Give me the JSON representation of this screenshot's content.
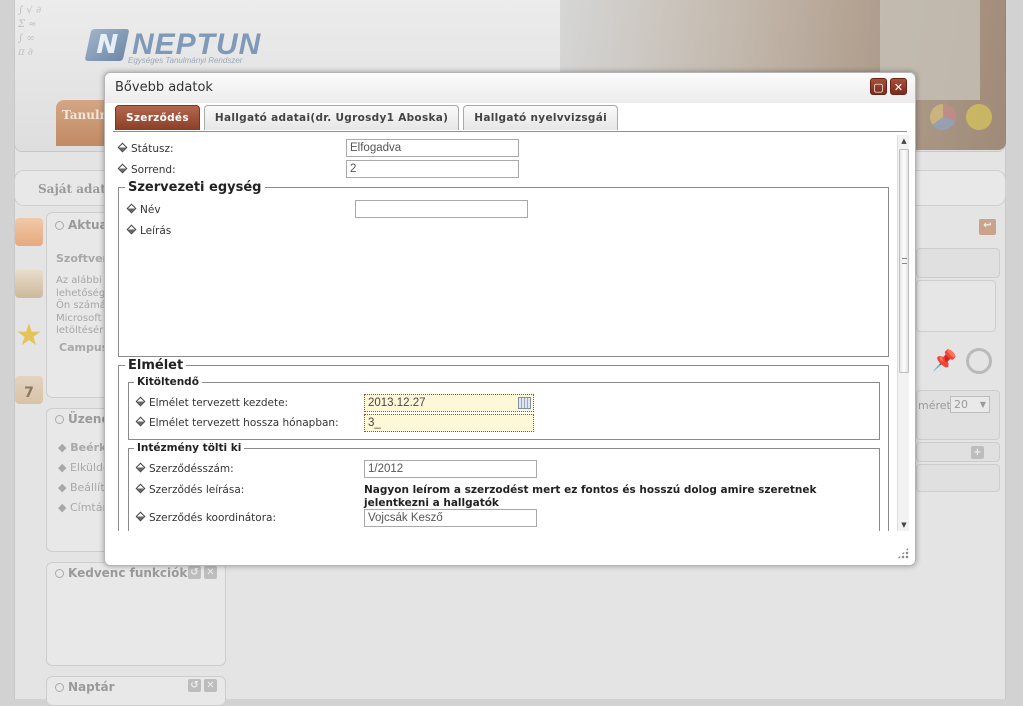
{
  "background": {
    "logo_text": "NEPTUN",
    "logo_sub": "Egységes Tanulmányi Rendszer",
    "tab_partial": "Tanulm",
    "strip_partial": "Saját adatok",
    "aktual_title": "Aktuali",
    "aktual_heading": "Szoftver",
    "aktual_lines": [
      "Az alábbi",
      "lehetőség",
      "Ön számá",
      "Microsoft",
      "letöltésér"
    ],
    "aktual_link": "Campus",
    "uzenet_title": "Üzenet",
    "uzenet_items": [
      "Beérk",
      "Elküldö",
      "Beállít",
      "Címtár"
    ],
    "kedvenc_title": "Kedvenc funkciók",
    "naptar_title": "Naptár",
    "meret_label": "méret",
    "meret_value": "20",
    "calendar_day": "7"
  },
  "modal": {
    "title": "Bővebb adatok",
    "tabs": [
      {
        "label": "Szerződés",
        "active": true
      },
      {
        "label": "Hallgató adatai(dr. Ugrosdy1 Aboska)",
        "active": false
      },
      {
        "label": "Hallgató nyelvvizsgái",
        "active": false
      }
    ],
    "fields": {
      "status_label": "Státusz:",
      "status_value": "Elfogadva",
      "sorrend_label": "Sorrend:",
      "sorrend_value": "2"
    },
    "szervezeti": {
      "legend": "Szervezeti egység",
      "nev_label": "Név",
      "nev_value": "",
      "leiras_label": "Leírás"
    },
    "elmelet": {
      "legend": "Elmélet",
      "kitoltendo_legend": "Kitöltendő",
      "kezdete_label": "Elmélet tervezett kezdete:",
      "kezdete_value": "2013.12.27",
      "hossza_label": "Elmélet tervezett hossza hónapban:",
      "hossza_value": "3_",
      "intezmeny_legend": "Intézmény tölti ki",
      "szerzodesszam_label": "Szerződésszám:",
      "szerzodesszam_value": "1/2012",
      "leirasa_label": "Szerződés leírása:",
      "leirasa_value": "Nagyon leírom a szerzodést mert ez fontos és hosszú dolog amire szeretnek jelentkezni a hallgatók",
      "koordinator_label": "Szerződés koordinátora:",
      "koordinator_value": "Vojcsák Kesző"
    }
  },
  "colors": {
    "tab_active": "#9c4a32",
    "close_button": "#8e3a27",
    "highlight_input": "#fff8d8"
  }
}
